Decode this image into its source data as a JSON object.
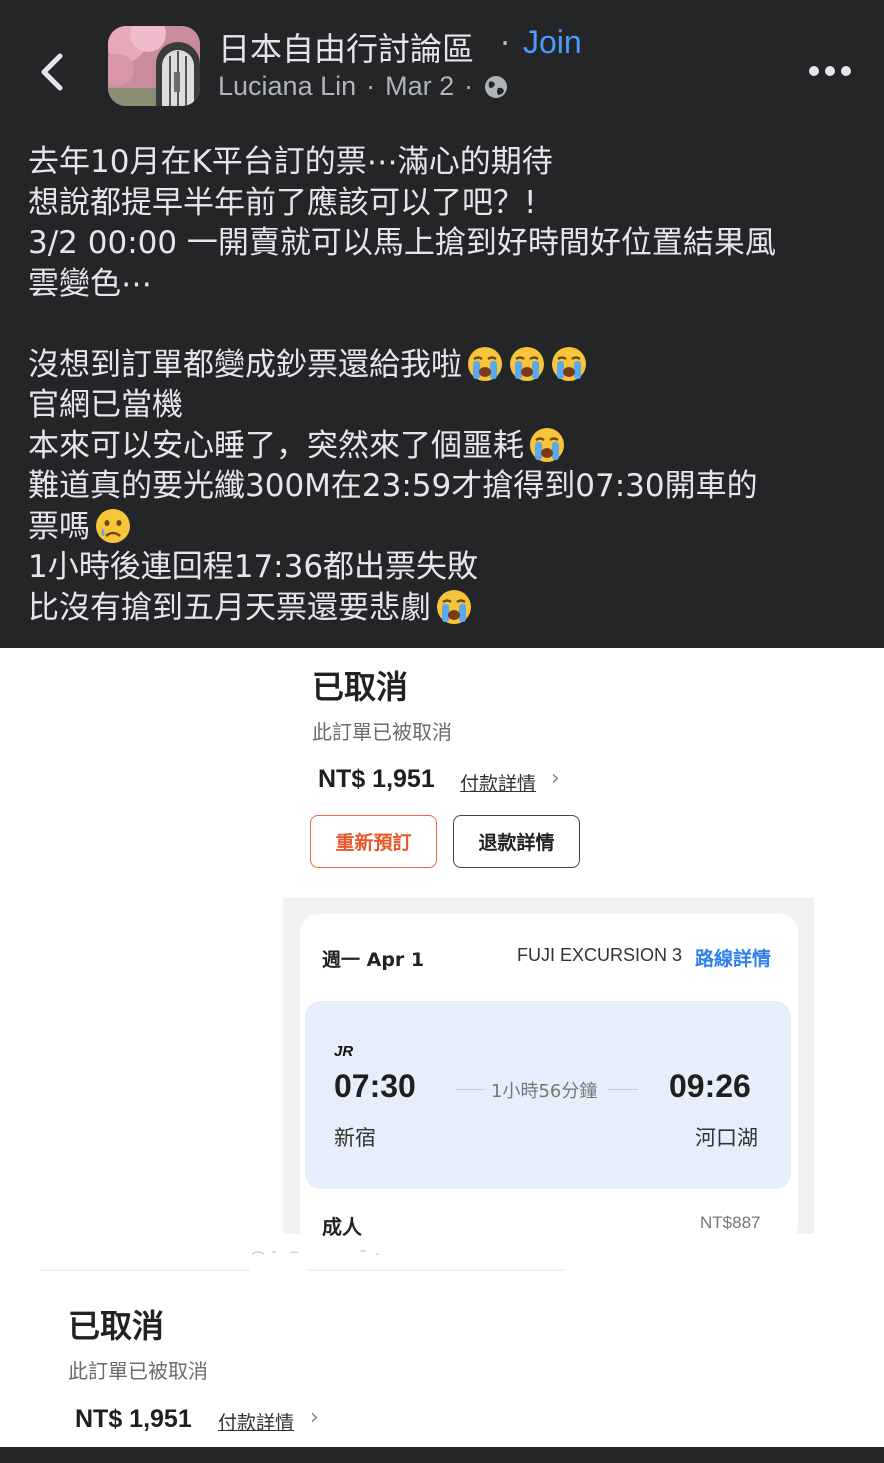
{
  "header": {
    "group_name": "日本自由行討論區",
    "separator": "·",
    "join_label": "Join",
    "author": "Luciana Lin",
    "date": "Mar 2"
  },
  "icons": {
    "back": "chevron-left-icon",
    "privacy": "globe-icon",
    "more": "more-horizontal-icon",
    "emoji": "loudly-crying-face-emoji",
    "emoji_small": "crying-face-emoji"
  },
  "post": {
    "line1": "去年10月在K平台訂的票⋯滿心的期待",
    "line2": "想說都提早半年前了應該可以了吧？!",
    "line3": "3/2 00:00 一開賣就可以馬上搶到好時間好位置結果風",
    "line4": "雲變色⋯",
    "line5": "沒想到訂單都變成鈔票還給我啦",
    "line6": "官網已當機",
    "line7": "本來可以安心睡了，突然來了個噩耗",
    "line8": "難道真的要光纖300M在23:59才搶得到07:30開車的",
    "line9": "票嗎",
    "line10": "1小時後連回程17:36都出票失敗",
    "line11": "比沒有搶到五月天票還要悲劇"
  },
  "order1": {
    "status": "已取消",
    "subtitle": "此訂單已被取消",
    "price": "NT$ 1,951",
    "payment_link": "付款詳情",
    "rebook_label": "重新預訂",
    "refund_label": "退款詳情"
  },
  "trip": {
    "date": "週一 Apr 1",
    "train": "FUJI EXCURSION 3",
    "route_link": "路線詳情",
    "operator": "JR",
    "depart_time": "07:30",
    "duration": "1小時56分鐘",
    "arrive_time": "09:26",
    "depart_station": "新宿",
    "arrive_station": "河口湖",
    "passenger_type": "成人",
    "passenger_price": "NT$887"
  },
  "order2": {
    "status": "已取消",
    "subtitle": "此訂單已被取消",
    "price": "NT$ 1,951",
    "payment_link": "付款詳情"
  },
  "colors": {
    "post_bg": "#242526",
    "join": "#4b9bff",
    "rebook": "#e8582a",
    "route_link": "#2f7ff0",
    "time_panel": "#e6eefb"
  }
}
